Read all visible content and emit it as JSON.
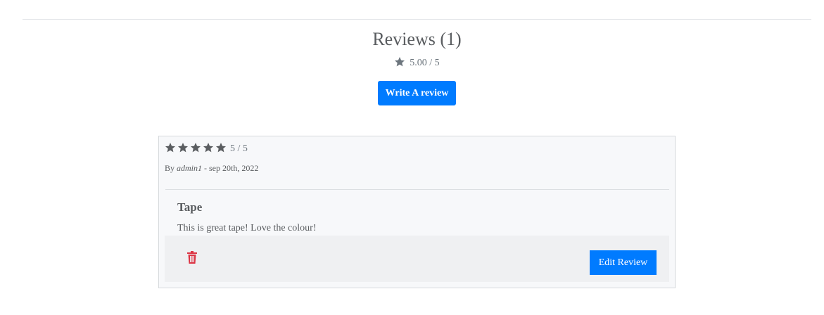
{
  "reviews_section": {
    "title": "Reviews (1)",
    "average_rating": "5.00 / 5",
    "write_review_label": "Write A review"
  },
  "review": {
    "stars": 5,
    "rating_text": "5 / 5",
    "by_prefix": "By ",
    "author": "admin1",
    "date_text": " - sep 20th, 2022",
    "title": "Tape",
    "body": "This is great tape! Love the colour!",
    "edit_label": "Edit Review"
  },
  "colors": {
    "primary": "#007bff",
    "danger": "#dc3545",
    "star": "#5a5d60",
    "avg_star": "#6c757d"
  },
  "icons": {
    "average_star": "star-icon",
    "rating_star": "star-icon",
    "delete": "trash-icon"
  }
}
